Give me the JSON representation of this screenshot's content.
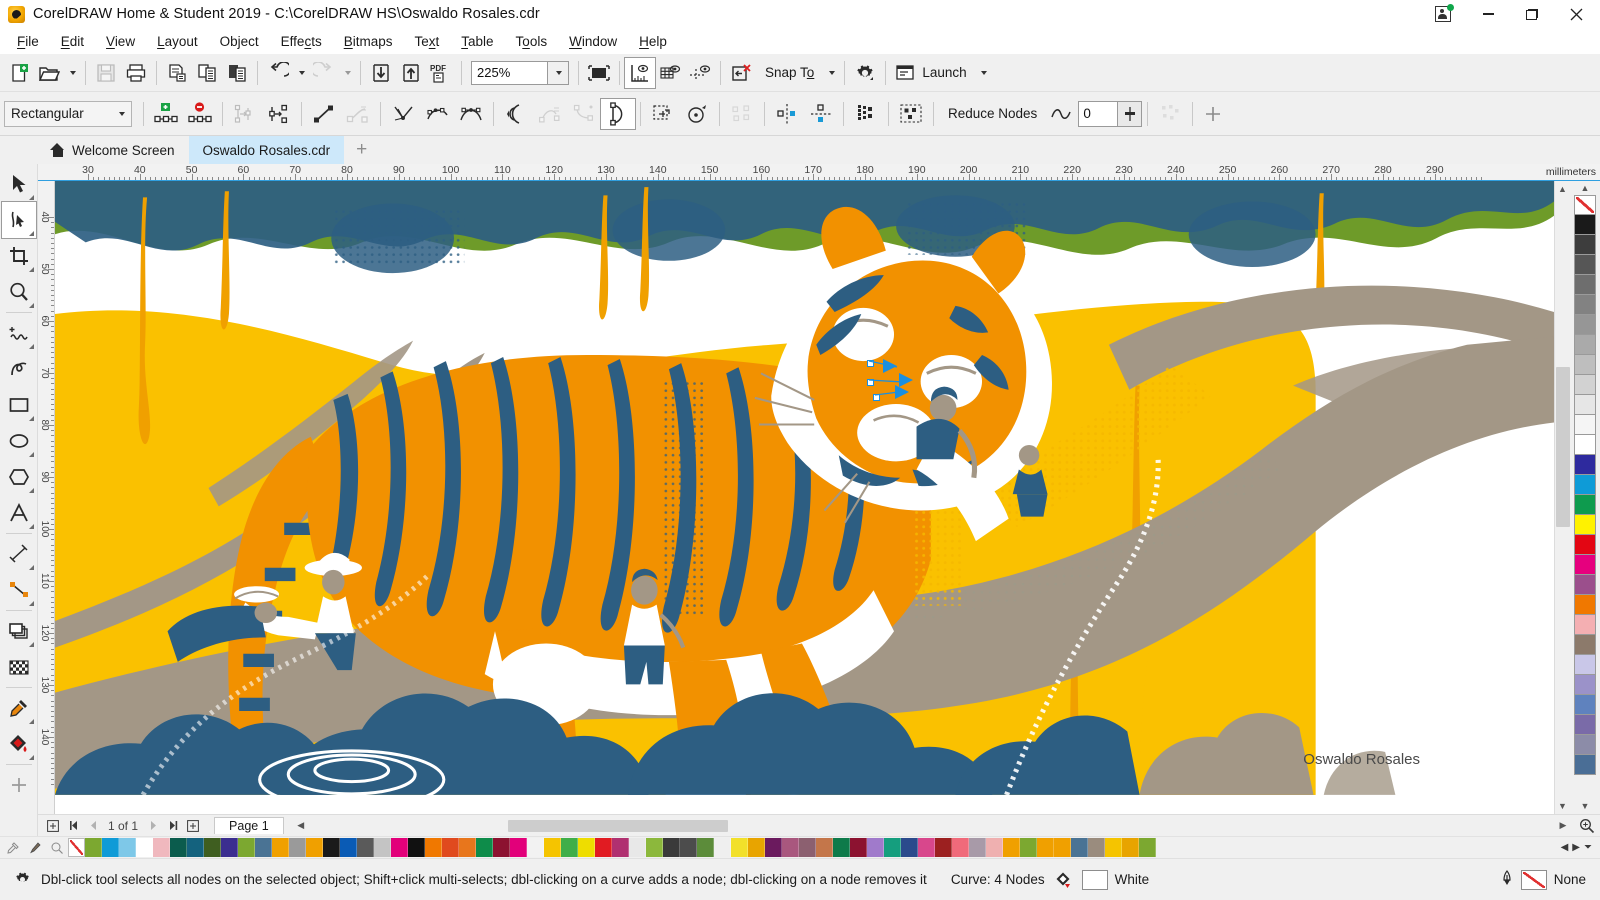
{
  "window": {
    "title": "CorelDRAW Home & Student 2019 - C:\\CorelDRAW HS\\Oswaldo Rosales.cdr",
    "app_icon": "coreldraw-balloon-icon",
    "controls": {
      "signin": "sign-in-icon",
      "minimize": "minimize-button",
      "restore": "restore-button",
      "close": "close-button"
    }
  },
  "menubar": {
    "items": [
      {
        "label": "File",
        "mnemonic": "F"
      },
      {
        "label": "Edit",
        "mnemonic": "E"
      },
      {
        "label": "View",
        "mnemonic": "V"
      },
      {
        "label": "Layout",
        "mnemonic": "L"
      },
      {
        "label": "Object",
        "mnemonic": "O"
      },
      {
        "label": "Effects",
        "mnemonic": "c"
      },
      {
        "label": "Bitmaps",
        "mnemonic": "B"
      },
      {
        "label": "Text",
        "mnemonic": "x"
      },
      {
        "label": "Table",
        "mnemonic": "T"
      },
      {
        "label": "Tools",
        "mnemonic": "o"
      },
      {
        "label": "Window",
        "mnemonic": "W"
      },
      {
        "label": "Help",
        "mnemonic": "H"
      }
    ]
  },
  "toolbar": {
    "items": [
      {
        "name": "new-document-button",
        "tip": "New"
      },
      {
        "name": "open-document-button",
        "tip": "Open"
      },
      {
        "name": "open-dropdown",
        "tip": "Open recent"
      },
      {
        "name": "save-button",
        "tip": "Save",
        "disabled": true
      },
      {
        "name": "print-button",
        "tip": "Print"
      },
      {
        "name": "cut-button",
        "tip": "Cut"
      },
      {
        "name": "copy-button",
        "tip": "Copy"
      },
      {
        "name": "paste-button",
        "tip": "Paste"
      },
      {
        "name": "undo-button",
        "tip": "Undo"
      },
      {
        "name": "undo-dropdown",
        "tip": "Undo list"
      },
      {
        "name": "redo-button",
        "tip": "Redo",
        "disabled": true
      },
      {
        "name": "redo-dropdown",
        "tip": "Redo list",
        "disabled": true
      },
      {
        "name": "import-button",
        "tip": "Import"
      },
      {
        "name": "export-button",
        "tip": "Export"
      },
      {
        "name": "publish-pdf-button",
        "tip": "Export to PDF"
      }
    ],
    "zoom": {
      "value": "225%",
      "label": "Zoom level"
    },
    "fullscreen": {
      "name": "full-screen-preview-button"
    },
    "show_rulers": {
      "name": "show-rulers-button",
      "active": true
    },
    "show_grid": {
      "name": "show-grid-button"
    },
    "show_guides": {
      "name": "show-guidelines-button"
    },
    "clear_transform": {
      "name": "clear-transformations-button"
    },
    "snap_to": {
      "label": "Snap To"
    },
    "options": {
      "name": "options-gear-button"
    },
    "launch": {
      "label": "Launch"
    }
  },
  "propertybar": {
    "selection_mode": "Rectangular",
    "reduce_nodes_label": "Reduce Nodes",
    "curve_smoothness": "0",
    "tools": [
      {
        "name": "add-node-button"
      },
      {
        "name": "delete-node-button"
      },
      {
        "name": "join-two-nodes-button",
        "disabled": true
      },
      {
        "name": "break-curve-button"
      },
      {
        "name": "convert-to-line-button"
      },
      {
        "name": "convert-to-curve-button",
        "disabled": true
      },
      {
        "name": "make-node-cusp-button"
      },
      {
        "name": "make-node-smooth-button"
      },
      {
        "name": "make-node-symmetrical-button"
      },
      {
        "name": "reverse-direction-button"
      },
      {
        "name": "extend-curve-to-close-button",
        "disabled": true
      },
      {
        "name": "extract-subpath-button",
        "disabled": true
      },
      {
        "name": "close-curve-button",
        "active": true
      },
      {
        "name": "stretch-scale-nodes-button"
      },
      {
        "name": "rotate-skew-nodes-button"
      },
      {
        "name": "align-nodes-button",
        "disabled": true
      },
      {
        "name": "reflect-nodes-horizontally-button"
      },
      {
        "name": "reflect-nodes-vertically-button"
      },
      {
        "name": "elastic-mode-button"
      },
      {
        "name": "select-all-nodes-button"
      },
      {
        "name": "select-similar-nodes-button",
        "disabled": true
      }
    ]
  },
  "tabs": {
    "items": [
      {
        "label": "Welcome Screen",
        "icon": "home-icon",
        "active": false
      },
      {
        "label": "Oswaldo Rosales.cdr",
        "active": true
      }
    ],
    "new_tab": "+"
  },
  "toolbox": {
    "items": [
      {
        "name": "pick-tool",
        "glyph": "arrow",
        "selected": false,
        "flyout": true
      },
      {
        "name": "shape-tool",
        "glyph": "node-edit",
        "selected": true,
        "flyout": true
      },
      {
        "name": "crop-tool",
        "glyph": "crop",
        "selected": false,
        "flyout": true
      },
      {
        "name": "zoom-tool",
        "glyph": "magnifier",
        "selected": false,
        "flyout": true
      },
      {
        "name": "freehand-tool",
        "glyph": "freehand",
        "selected": false,
        "flyout": true
      },
      {
        "name": "smart-fill-tool",
        "glyph": "smart-drawing",
        "selected": false,
        "flyout": false
      },
      {
        "name": "rectangle-tool",
        "glyph": "rectangle",
        "selected": false,
        "flyout": true
      },
      {
        "name": "ellipse-tool",
        "glyph": "ellipse",
        "selected": false,
        "flyout": true
      },
      {
        "name": "polygon-tool",
        "glyph": "polygon",
        "selected": false,
        "flyout": true
      },
      {
        "name": "text-tool",
        "glyph": "letter-a",
        "selected": false,
        "flyout": true
      },
      {
        "name": "parallel-dimension-tool",
        "glyph": "dimension-line",
        "selected": false,
        "flyout": true
      },
      {
        "name": "straight-line-connector-tool",
        "glyph": "connector",
        "selected": false,
        "flyout": true
      },
      {
        "name": "drop-shadow-tool",
        "glyph": "shadow-rects",
        "selected": false,
        "flyout": true
      },
      {
        "name": "transparency-tool",
        "glyph": "checker",
        "selected": false,
        "flyout": false
      },
      {
        "name": "color-eyedropper-tool",
        "glyph": "eyedropper",
        "selected": false,
        "flyout": true
      },
      {
        "name": "interactive-fill-tool",
        "glyph": "fill-bucket",
        "selected": false,
        "flyout": true
      },
      {
        "name": "customize-toolbox-button",
        "glyph": "plus",
        "selected": false,
        "flyout": false
      }
    ]
  },
  "rulers": {
    "unit": "millimeters",
    "h_labels": [
      "30",
      "40",
      "50",
      "60",
      "70",
      "80",
      "90",
      "100",
      "110",
      "120",
      "130",
      "140",
      "150",
      "160",
      "170",
      "180",
      "190",
      "200",
      "210",
      "220",
      "230",
      "240",
      "250",
      "260",
      "270",
      "280",
      "290"
    ],
    "v_labels": [
      "40",
      "50",
      "60",
      "70",
      "80",
      "90",
      "100",
      "110",
      "120",
      "130",
      "140"
    ]
  },
  "canvas": {
    "artwork_title": "tiger-illustration",
    "signature": "Oswaldo Rosales",
    "colors": {
      "orange": "#F29100",
      "deep_orange": "#E98A00",
      "blue": "#2D5E82",
      "green": "#6E9B29",
      "yellow": "#FAC100",
      "grey": "#A39786",
      "white": "#FFFFFF",
      "selection": "#1A8FE0"
    }
  },
  "pagenav": {
    "first": "first-page-button",
    "prev_page": "previous-page-button",
    "prev": "previous-page-arrow",
    "count": "1 of 1",
    "next": "next-page-arrow",
    "last": "last-page-button",
    "add_page": "add-page-button",
    "page_tab": "Page 1"
  },
  "statusbar": {
    "hint": "Dbl-click tool selects all nodes on the selected object; Shift+click multi-selects; dbl-clicking on a curve adds a node; dbl-clicking on a node removes it",
    "object_info": "Curve: 4 Nodes",
    "fill_label": "White",
    "fill_color": "#FFFFFF",
    "outline_label": "None",
    "fill_icon": "fill-color-icon",
    "outline_icon": "outline-pen-icon",
    "hint_icon": "gear-icon"
  },
  "palette": {
    "name": "default-cmyk-palette",
    "tools": [
      "eyedropper-icon",
      "paintbrush-icon",
      "magnifier-icon"
    ],
    "swatches": [
      "#7CA830",
      "#0F9BD7",
      "#7EC8E8",
      "#FFFFFF",
      "#F0B8BE",
      "#0B5C4D",
      "#14627E",
      "#3F5E20",
      "#3B2E8F",
      "#7CA830",
      "#4A7394",
      "#F0A000",
      "#9A9A9A",
      "#F0A000",
      "#1A1A1A",
      "#0A5BB5",
      "#5A5A5A",
      "#C4C4C4",
      "#E2007A",
      "#111111",
      "#F07800",
      "#E04A1E",
      "#E8761C",
      "#0E8C4A",
      "#8C1230",
      "#E2007A",
      "#F2F2F2",
      "#F5C400",
      "#3FAE49",
      "#EEDD00",
      "#E11B22",
      "#B03070",
      "#E8E8E8",
      "#8CB83C",
      "#3A3A3A",
      "#4C4C4C",
      "#5C8C3A",
      "#EFEFEF",
      "#F2E02A",
      "#E8A400",
      "#6B1A5E",
      "#A9577E",
      "#8C6070",
      "#C4764A",
      "#0E7A4A",
      "#8C1230",
      "#A07ACB",
      "#159E7E",
      "#2B4A8C",
      "#D8478C",
      "#9C2020",
      "#F06A7A",
      "#A89AA8",
      "#EFB0B0",
      "#F0A000",
      "#7CA830",
      "#F0A000",
      "#F0A000",
      "#4A7394",
      "#9A8C7E",
      "#F5C400",
      "#E8A400",
      "#7CA830"
    ],
    "scroll_left": "palette-scroll-left",
    "scroll_right": "palette-scroll-right",
    "expand": "palette-expand"
  },
  "right_palette": {
    "swatches": [
      "#1A1A1A",
      "#3D3D3D",
      "#565656",
      "#6E6E6E",
      "#828282",
      "#969696",
      "#AAAAAA",
      "#BEBEBE",
      "#D2D2D2",
      "#E6E6E6",
      "#F5F5F5",
      "#FFFFFF",
      "#2E2A9E",
      "#0E9BD7",
      "#0E9B4E",
      "#FFF200",
      "#E30613",
      "#E6007E",
      "#9B4F8C",
      "#F07800",
      "#F4AFB2",
      "#8C7A6B",
      "#C9C7E8",
      "#9B92C9",
      "#5F82BE",
      "#7A6BA8",
      "#8C8CA8",
      "#4A6E96"
    ],
    "none_swatch": "no-color-swatch",
    "scroll_up": "palette-scroll-up",
    "scroll_down": "palette-scroll-down"
  }
}
